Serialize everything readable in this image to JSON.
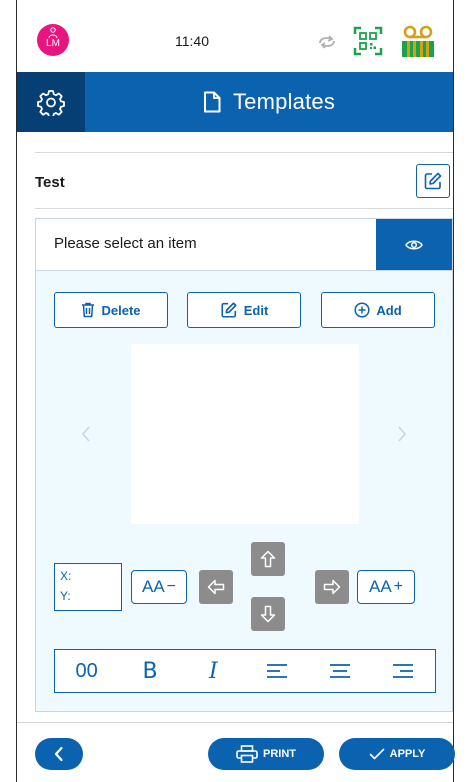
{
  "status_bar": {
    "avatar_initials": "LM",
    "time": "11:40",
    "icons": [
      "person-icon",
      "sync-icon",
      "qr-code-icon",
      "voicemail-icon"
    ]
  },
  "header": {
    "title": "Templates",
    "icons": [
      "gear-icon",
      "document-icon"
    ]
  },
  "template": {
    "name": "Test"
  },
  "selector": {
    "placeholder": "Please select an item"
  },
  "editor": {
    "actions": {
      "delete_label": "Delete",
      "edit_label": "Edit",
      "add_label": "Add"
    },
    "coords": {
      "x_label": "X:",
      "y_label": "Y:"
    },
    "font_decrease": {
      "label": "AA",
      "op": "−"
    },
    "font_increase": {
      "label": "AA",
      "op": "+"
    },
    "format_bar": {
      "counter": "00",
      "bold": "B",
      "italic": "I"
    }
  },
  "footer": {
    "print_label": "PRINT",
    "apply_label": "APPLY"
  },
  "colors": {
    "brand": "#0b63b0",
    "brand_dark": "#063f73",
    "avatar": "#e6157f",
    "qr_green": "#1aa34a",
    "voicemail_gold": "#d4a017",
    "panel_bg": "#eefaff",
    "arrow_grey": "#8c8c8c"
  }
}
